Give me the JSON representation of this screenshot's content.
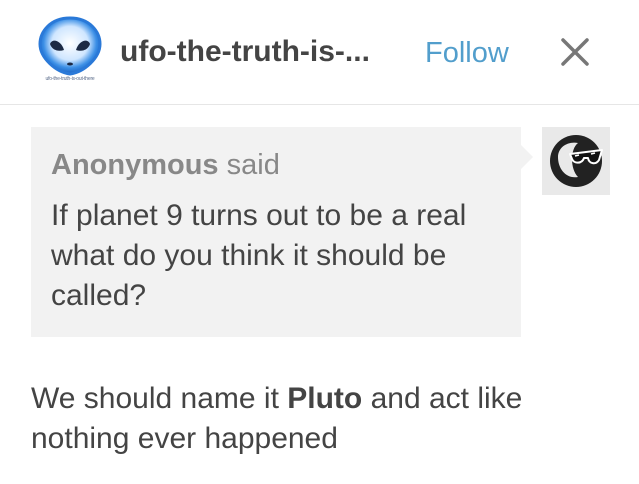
{
  "header": {
    "blog_name": "ufo-the-truth-is-...",
    "avatar_caption": "ufo-the-truth-is-out-there",
    "follow_label": "Follow",
    "avatar_icon": "alien-head-icon",
    "close_icon": "close-icon"
  },
  "ask": {
    "asker_name": "Anonymous",
    "asker_verb": "said",
    "question": "If planet 9 turns out to be a real what do you think it should be called?",
    "asker_avatar_icon": "sunglasses-face-icon"
  },
  "answer": {
    "text_before": "We should name it ",
    "bold": "Pluto",
    "text_after": " and act like nothing ever happened"
  },
  "colors": {
    "follow": "#529ecc",
    "text": "#444444",
    "muted": "#888888",
    "bubble": "#f2f2f2"
  }
}
